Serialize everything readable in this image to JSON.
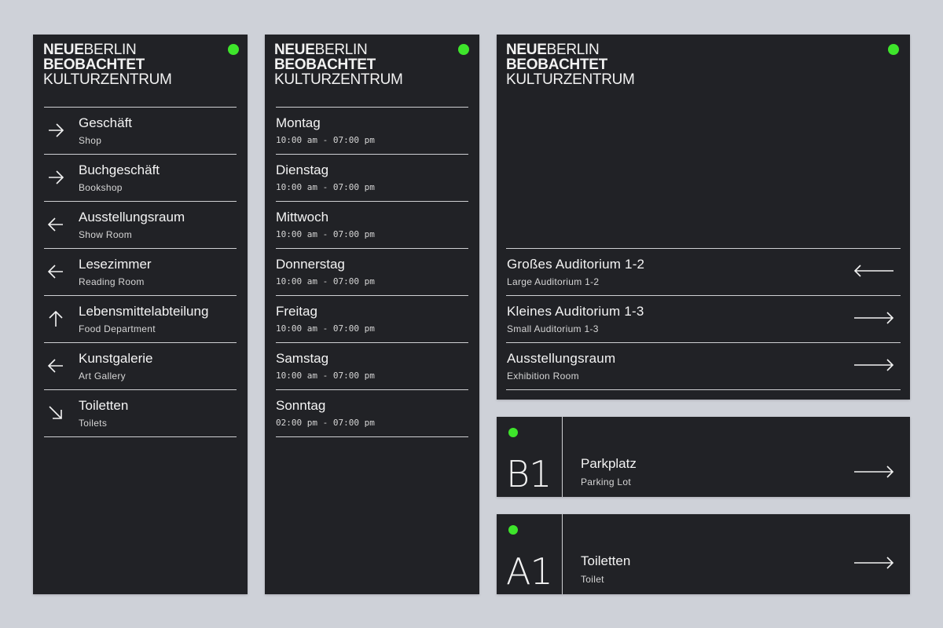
{
  "brand": {
    "neue": "NEUE",
    "berlin": "BERLIN",
    "beobachtet": "BEOBACHTET",
    "kulturzentrum": "KULTURZENTRUM"
  },
  "accent_color": "#3ee52b",
  "directory": {
    "items": [
      {
        "title": "Geschäft",
        "subtitle": "Shop",
        "icon": "arrow-right-icon"
      },
      {
        "title": "Buchgeschäft",
        "subtitle": "Bookshop",
        "icon": "arrow-right-icon"
      },
      {
        "title": "Ausstellungsraum",
        "subtitle": "Show Room",
        "icon": "arrow-left-icon"
      },
      {
        "title": "Lesezimmer",
        "subtitle": "Reading Room",
        "icon": "arrow-left-icon"
      },
      {
        "title": "Lebensmittelabteilung",
        "subtitle": "Food Department",
        "icon": "arrow-up-icon"
      },
      {
        "title": "Kunstgalerie",
        "subtitle": "Art Gallery",
        "icon": "arrow-left-icon"
      },
      {
        "title": "Toiletten",
        "subtitle": "Toilets",
        "icon": "arrow-down-right-icon"
      }
    ]
  },
  "hours": {
    "days": [
      {
        "day": "Montag",
        "time": "10:00 am - 07:00 pm"
      },
      {
        "day": "Dienstag",
        "time": "10:00 am - 07:00 pm"
      },
      {
        "day": "Mittwoch",
        "time": "10:00 am - 07:00 pm"
      },
      {
        "day": "Donnerstag",
        "time": "10:00 am - 07:00 pm"
      },
      {
        "day": "Freitag",
        "time": "10:00 am - 07:00 pm"
      },
      {
        "day": "Samstag",
        "time": "10:00 am - 07:00 pm"
      },
      {
        "day": "Sonntag",
        "time": "02:00 pm - 07:00 pm"
      }
    ]
  },
  "auditorium": {
    "items": [
      {
        "title": "Großes Auditorium 1-2",
        "subtitle": "Large Auditorium 1-2",
        "icon": "long-arrow-left-icon"
      },
      {
        "title": "Kleines Auditorium 1-3",
        "subtitle": "Small Auditorium 1-3",
        "icon": "long-arrow-right-icon"
      },
      {
        "title": "Ausstellungsraum",
        "subtitle": "Exhibition Room",
        "icon": "long-arrow-right-icon"
      }
    ]
  },
  "level_b1": {
    "code": "B1",
    "title": "Parkplatz",
    "subtitle": "Parking Lot",
    "icon": "long-arrow-right-icon"
  },
  "level_a1": {
    "code": "A1",
    "title": "Toiletten",
    "subtitle": "Toilet",
    "icon": "long-arrow-right-icon"
  }
}
